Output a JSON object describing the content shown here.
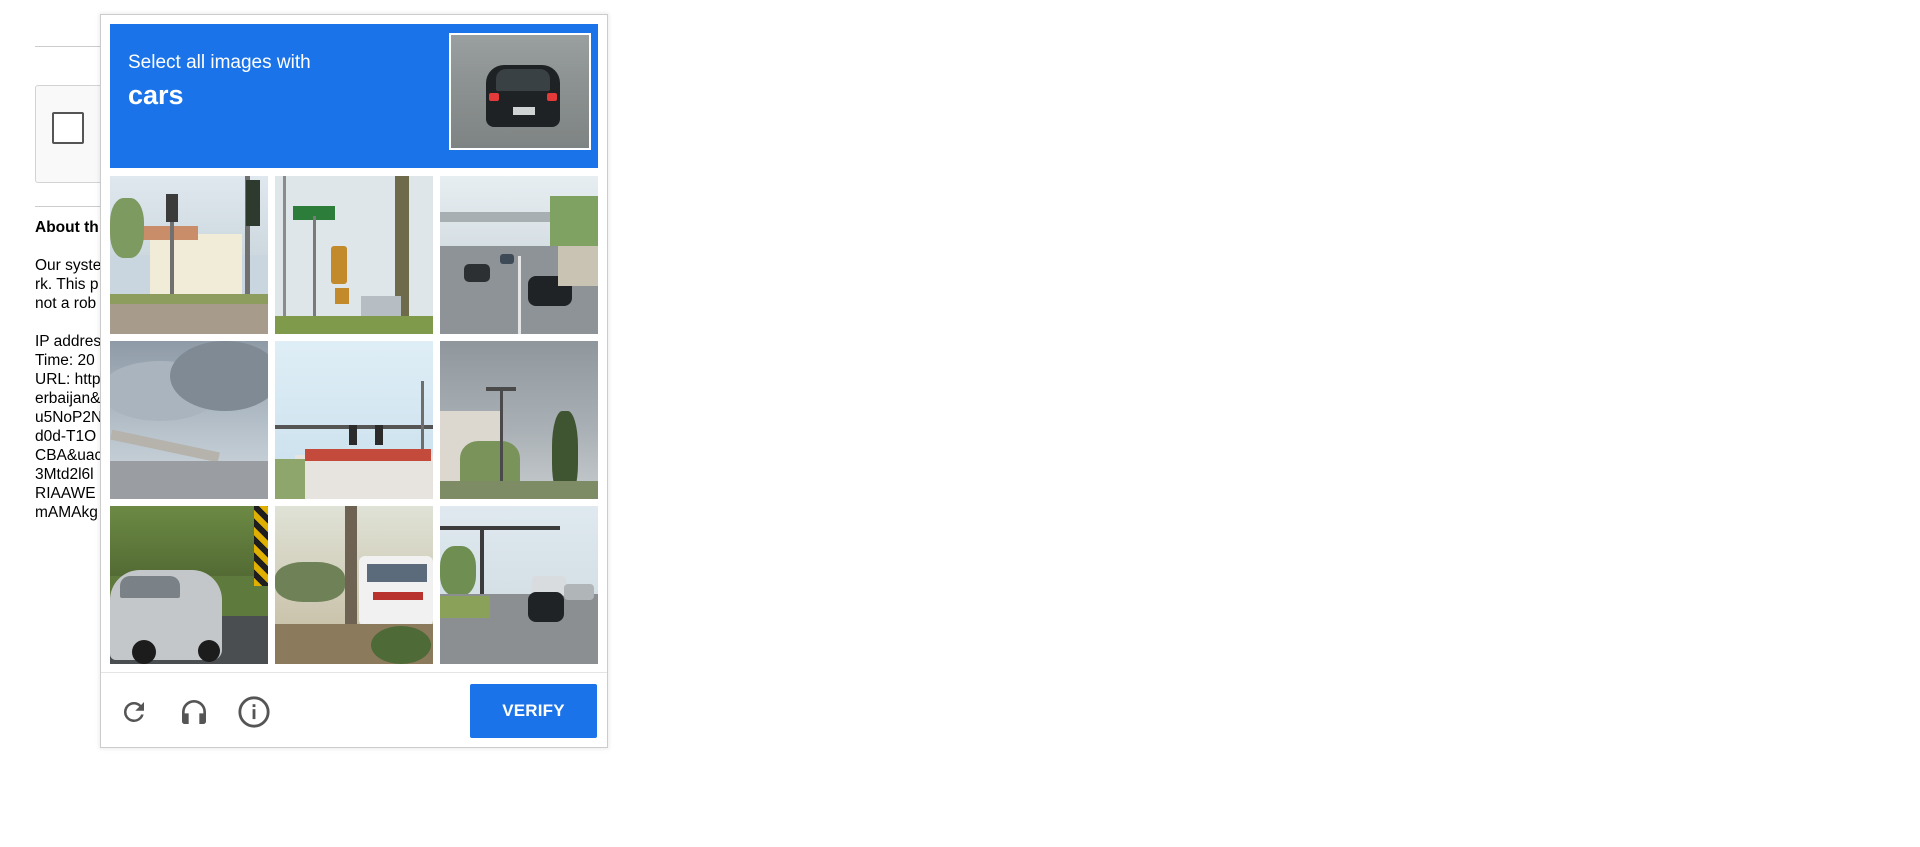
{
  "background_page": {
    "about_heading": "About th",
    "about_lines": [
      "Our syste",
      "rk. This p",
      "not a rob"
    ],
    "info_lines": [
      "IP addres",
      "Time: 20",
      "URL: http",
      "erbaijan&",
      "u5NoP2N",
      "d0d-T1O",
      "CBA&uac",
      "3Mtd2l6l",
      "RIAAWE",
      "mAMAkg"
    ]
  },
  "challenge": {
    "instruction": "Select all images with",
    "target": "cars",
    "tiles": [
      {
        "index": 1,
        "description": "traffic-lights-and-house"
      },
      {
        "index": 2,
        "description": "street-sign-and-traffic-light"
      },
      {
        "index": 3,
        "description": "highway-with-cars"
      },
      {
        "index": 4,
        "description": "overpass-and-clouds"
      },
      {
        "index": 5,
        "description": "traffic-lights-row-houses"
      },
      {
        "index": 6,
        "description": "cloudy-street-with-lamp"
      },
      {
        "index": 7,
        "description": "silver-car-roadside"
      },
      {
        "index": 8,
        "description": "bus-behind-tree"
      },
      {
        "index": 9,
        "description": "intersection-with-cars"
      }
    ],
    "footer": {
      "reload_icon": "reload-icon",
      "audio_icon": "headphones-icon",
      "info_icon": "info-icon",
      "verify_label": "VERIFY"
    },
    "colors": {
      "accent": "#1a73e8",
      "icon": "#555555"
    }
  }
}
